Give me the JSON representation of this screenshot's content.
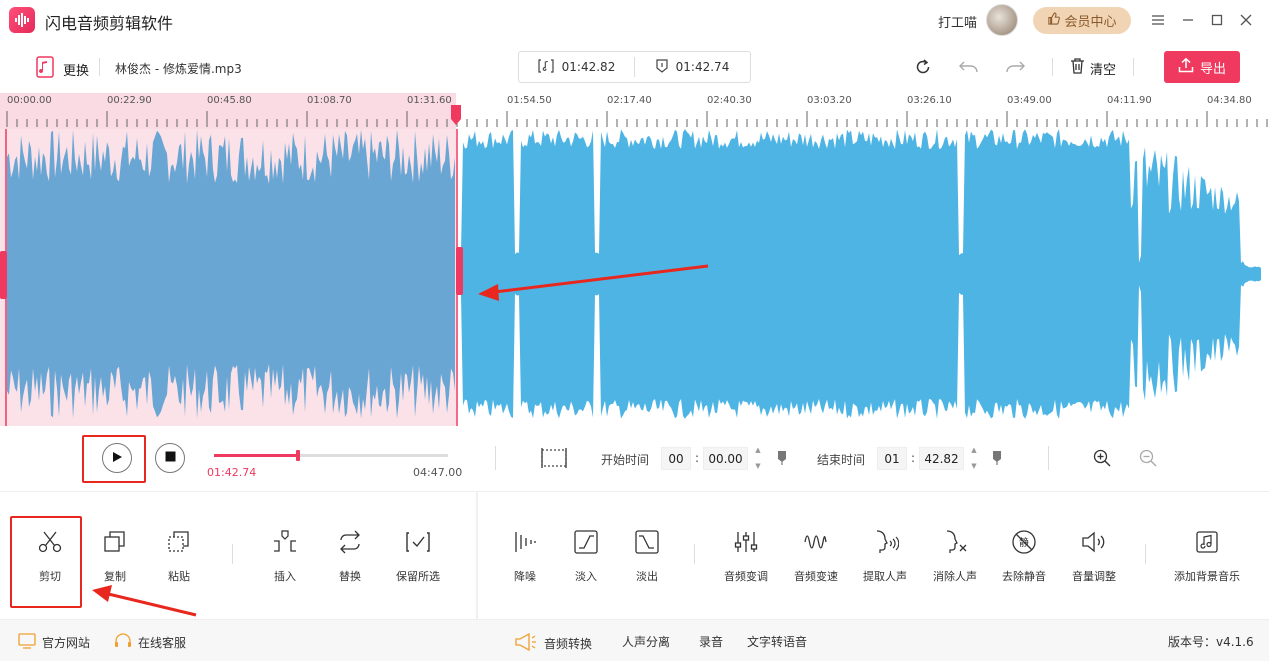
{
  "app": {
    "title": "闪电音频剪辑软件"
  },
  "user": {
    "name": "打工喵",
    "vip_label": "会员中心"
  },
  "toolbar": {
    "replace_label": "更换",
    "filename": "林俊杰 - 修炼爱情.mp3",
    "selection_duration": "01:42.82",
    "playhead_time": "01:42.74",
    "clear_label": "清空",
    "export_label": "导出"
  },
  "ruler": {
    "labels": [
      "00:00.00",
      "00:22.90",
      "00:45.80",
      "01:08.70",
      "01:31.60",
      "01:54.50",
      "02:17.40",
      "02:40.30",
      "03:03.20",
      "03:26.10",
      "03:49.00",
      "04:11.90",
      "04:34.80"
    ]
  },
  "waveform": {
    "selection_color": "#f0395f",
    "selected_wave_color": "#6aa6d3",
    "wave_color": "#4eb4e4",
    "selection_end_time": "01:42.82",
    "total_duration": "04:47.00"
  },
  "transport": {
    "current_time": "01:42.74",
    "total_time": "04:47.00",
    "progress_fraction": 0.358,
    "start_label": "开始时间",
    "start_min": "00",
    "start_sec": "00.00",
    "end_label": "结束时间",
    "end_min": "01",
    "end_sec": "42.82"
  },
  "tools": {
    "cut": "剪切",
    "copy": "复制",
    "paste": "粘贴",
    "insert": "插入",
    "replace": "替换",
    "keep_selection": "保留所选",
    "denoise": "降噪",
    "fade_in": "淡入",
    "fade_out": "淡出",
    "pitch": "音频变调",
    "speed": "音频变速",
    "extract_vocal": "提取人声",
    "remove_vocal": "消除人声",
    "remove_silence": "去除静音",
    "volume": "音量调整",
    "add_bgm": "添加背景音乐"
  },
  "statusbar": {
    "official_site": "官方网站",
    "online_service": "在线客服",
    "audio_convert": "音频转换",
    "vocal_separate": "人声分离",
    "record": "录音",
    "tts": "文字转语音",
    "version": "版本号：v4.1.6"
  },
  "colors": {
    "accent": "#f0395f",
    "annotation_red": "#e8281e"
  }
}
